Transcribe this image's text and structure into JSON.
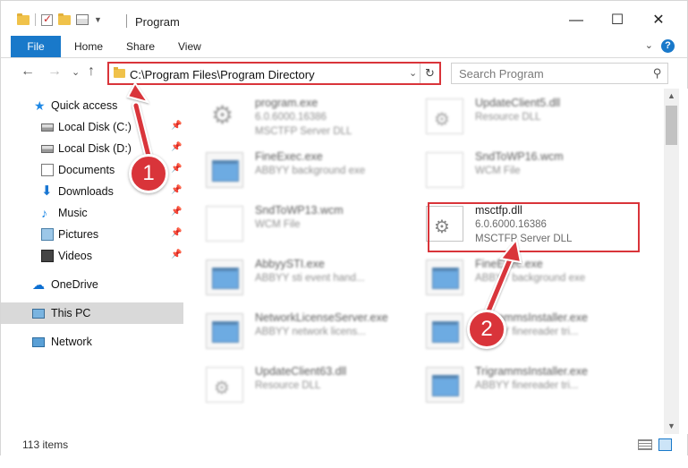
{
  "window": {
    "title": "Program",
    "minimize": "—",
    "maximize": "☐",
    "close": "✕"
  },
  "ribbon": {
    "tabs": [
      "File",
      "Home",
      "Share",
      "View"
    ],
    "help": "?",
    "expand": "⌄"
  },
  "nav": {
    "back": "←",
    "forward": "→",
    "recent": "⌄",
    "up": "↑"
  },
  "address": {
    "path": "C:\\Program Files\\Program Directory",
    "dropdown": "⌄",
    "refresh": "↻"
  },
  "search": {
    "placeholder": "Search Program",
    "icon": "search-icon"
  },
  "sidebar": {
    "items": [
      {
        "label": "Quick access",
        "icon": "star-icon",
        "pinned": false
      },
      {
        "label": "Local Disk (C:)",
        "icon": "disk-icon",
        "pinned": true
      },
      {
        "label": "Local Disk (D:)",
        "icon": "disk-icon",
        "pinned": true
      },
      {
        "label": "Documents",
        "icon": "documents-icon",
        "pinned": true
      },
      {
        "label": "Downloads",
        "icon": "downloads-icon",
        "pinned": true
      },
      {
        "label": "Music",
        "icon": "music-icon",
        "pinned": true
      },
      {
        "label": "Pictures",
        "icon": "pictures-icon",
        "pinned": true
      },
      {
        "label": "Videos",
        "icon": "videos-icon",
        "pinned": true
      },
      {
        "label": "OneDrive",
        "icon": "onedrive-icon",
        "pinned": false
      },
      {
        "label": "This PC",
        "icon": "pc-icon",
        "pinned": false,
        "selected": true
      },
      {
        "label": "Network",
        "icon": "network-icon",
        "pinned": false
      }
    ],
    "pin_glyph": "📌"
  },
  "files": [
    {
      "name": "program.exe",
      "line1": "6.0.6000.16386",
      "line2": "MSCTFP Server DLL",
      "icon": "gear-exe-icon",
      "blurred": true
    },
    {
      "name": "UpdateClient5.dll",
      "line1": "Resource DLL",
      "line2": "",
      "icon": "dll-icon",
      "blurred": true
    },
    {
      "name": "FineExec.exe",
      "line1": "ABBYY background exe",
      "line2": "",
      "icon": "exe-icon",
      "blurred": true
    },
    {
      "name": "SndToWP16.wcm",
      "line1": "WCM File",
      "line2": "",
      "icon": "wcm-icon",
      "blurred": true
    },
    {
      "name": "SndToWP13.wcm",
      "line1": "WCM File",
      "line2": "",
      "icon": "wcm-icon",
      "blurred": true
    },
    {
      "name": "msctfp.dll",
      "line1": "6.0.6000.16386",
      "line2": "MSCTFP Server DLL",
      "icon": "dll-icon",
      "blurred": false
    },
    {
      "name": "AbbyySTI.exe",
      "line1": "ABBYY sti event hand...",
      "line2": "",
      "icon": "exe-icon",
      "blurred": true
    },
    {
      "name": "FineExec.exe",
      "line1": "ABBYY background exe",
      "line2": "",
      "icon": "exe-icon",
      "blurred": true
    },
    {
      "name": "NetworkLicenseServer.exe",
      "line1": "ABBYY network licens...",
      "line2": "",
      "icon": "exe-icon",
      "blurred": true
    },
    {
      "name": "TrigrammsInstaller.exe",
      "line1": "ABBYY finereader tri...",
      "line2": "",
      "icon": "exe-icon",
      "blurred": true
    },
    {
      "name": "UpdateClient63.dll",
      "line1": "Resource DLL",
      "line2": "",
      "icon": "dll-icon",
      "blurred": true
    },
    {
      "name": "TrigrammsInstaller.exe",
      "line1": "ABBYY finereader tri...",
      "line2": "",
      "icon": "exe-icon",
      "blurred": true
    }
  ],
  "status": {
    "count": "113 items"
  },
  "callouts": [
    "1",
    "2"
  ],
  "colors": {
    "accent": "#1979ca",
    "highlight": "#d9343a",
    "selected": "#d9d9d9"
  }
}
